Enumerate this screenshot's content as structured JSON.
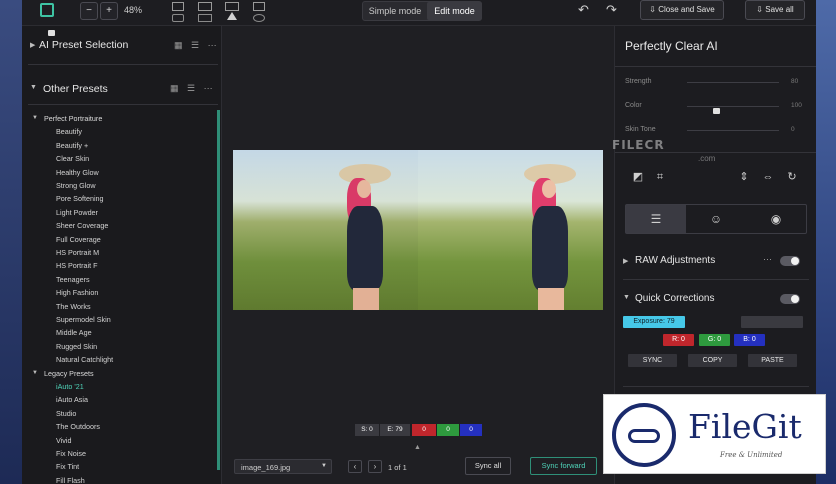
{
  "toolbar": {
    "zoom_out_label": "−",
    "zoom_in_label": "+",
    "zoom_level": "48%",
    "mode_simple": "Simple mode",
    "mode_edit": "Edit mode",
    "close_and_save": "Close and Save",
    "save_all": "Save all"
  },
  "left_panel": {
    "ai_preset_title": "AI Preset Selection",
    "other_presets_title": "Other Presets",
    "tree": [
      {
        "label": "Perfect Portraiture",
        "type": "category"
      },
      {
        "label": "Beautify",
        "type": "item"
      },
      {
        "label": "Beautify +",
        "type": "item"
      },
      {
        "label": "Clear Skin",
        "type": "item"
      },
      {
        "label": "Healthy Glow",
        "type": "item"
      },
      {
        "label": "Strong Glow",
        "type": "item"
      },
      {
        "label": "Pore Softening",
        "type": "item"
      },
      {
        "label": "Light Powder",
        "type": "item"
      },
      {
        "label": "Sheer Coverage",
        "type": "item"
      },
      {
        "label": "Full Coverage",
        "type": "item"
      },
      {
        "label": "HS Portrait M",
        "type": "item"
      },
      {
        "label": "HS Portrait F",
        "type": "item"
      },
      {
        "label": "Teenagers",
        "type": "item"
      },
      {
        "label": "High Fashion",
        "type": "item"
      },
      {
        "label": "The Works",
        "type": "item"
      },
      {
        "label": "Supermodel Skin",
        "type": "item"
      },
      {
        "label": "Middle Age",
        "type": "item"
      },
      {
        "label": "Rugged Skin",
        "type": "item"
      },
      {
        "label": "Natural Catchlight",
        "type": "item"
      },
      {
        "label": "Legacy Presets",
        "type": "category"
      },
      {
        "label": "iAuto '21",
        "type": "item",
        "selected": true
      },
      {
        "label": "iAuto Asia",
        "type": "item"
      },
      {
        "label": "Studio",
        "type": "item"
      },
      {
        "label": "The Outdoors",
        "type": "item"
      },
      {
        "label": "Vivid",
        "type": "item"
      },
      {
        "label": "Fix Noise",
        "type": "item"
      },
      {
        "label": "Fix Tint",
        "type": "item"
      },
      {
        "label": "Fill Flash",
        "type": "item"
      }
    ]
  },
  "center": {
    "histogram_chips": [
      {
        "label": "S: 0",
        "color": "#3a3a40"
      },
      {
        "label": "E: 79",
        "color": "#3a3a40"
      },
      {
        "label": "0",
        "color": "#c0262c"
      },
      {
        "label": "0",
        "color": "#2e9a3e"
      },
      {
        "label": "0",
        "color": "#2430c0"
      }
    ],
    "file_name": "image_169.jpg",
    "page_info": "1 of 1",
    "sync_all": "Sync all",
    "sync_forward": "Sync forward"
  },
  "right_panel": {
    "title": "Perfectly Clear AI",
    "sliders": [
      {
        "label": "Strength",
        "value": "80"
      },
      {
        "label": "Color",
        "value": "100"
      },
      {
        "label": "Skin Tone",
        "value": "0"
      }
    ],
    "raw_adjustments": "RAW Adjustments",
    "quick_corrections": "Quick Corrections",
    "exposure_label": "Exposure: 79",
    "rgb": {
      "r": "R: 0",
      "g": "G: 0",
      "b": "B: 0"
    },
    "sync_btn": "SYNC",
    "copy_btn": "COPY",
    "paste_btn": "PASTE"
  },
  "watermarks": {
    "filecr": "FILECR",
    "filecr_sub": ".com",
    "filegit_name": "FileGit",
    "filegit_tag": "Free & Unlimited"
  },
  "colors": {
    "accent_teal": "#2f8f78",
    "exposure_cyan": "#46c8e8",
    "red_chip": "#c0262c",
    "green_chip": "#2e9a3e",
    "blue_chip": "#2430c0"
  }
}
